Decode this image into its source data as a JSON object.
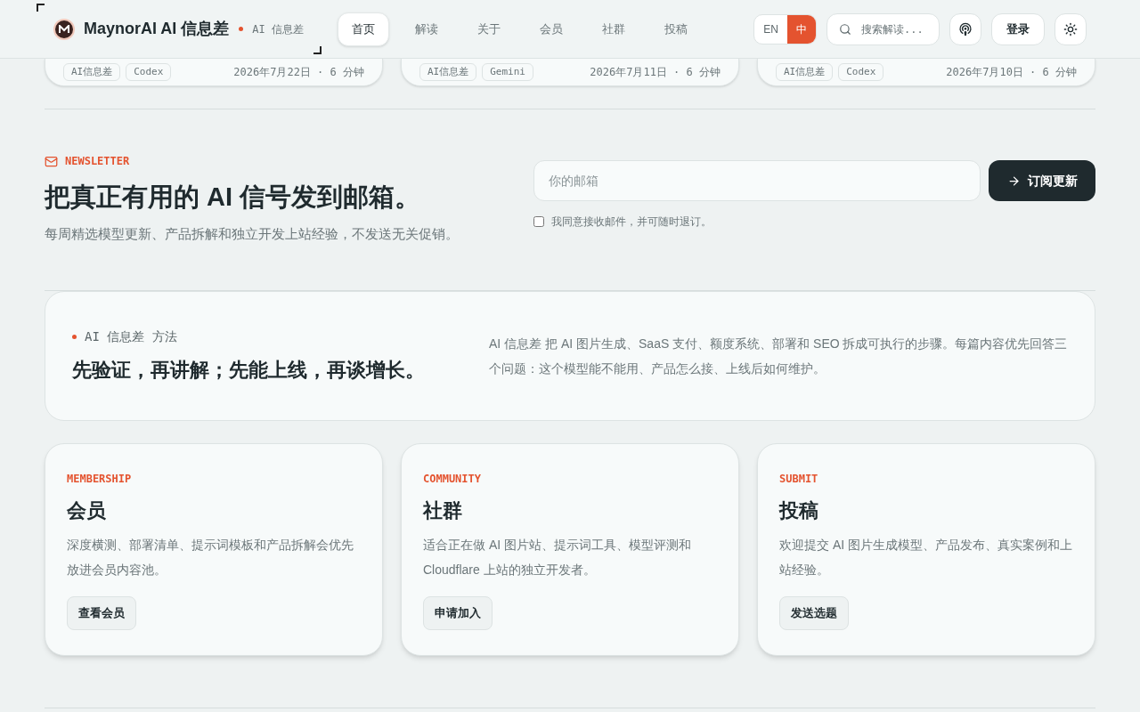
{
  "header": {
    "brand": "MaynorAI AI 信息差",
    "tagline": "AI 信息差",
    "nav": [
      {
        "label": "首页",
        "selected": true
      },
      {
        "label": "解读",
        "selected": false
      },
      {
        "label": "关于",
        "selected": false
      },
      {
        "label": "会员",
        "selected": false
      },
      {
        "label": "社群",
        "selected": false
      },
      {
        "label": "投稿",
        "selected": false
      }
    ],
    "languages": [
      {
        "label": "EN",
        "selected": false
      },
      {
        "label": "中",
        "selected": true
      }
    ],
    "search": {
      "placeholder": "搜索解读..."
    },
    "login": "登录"
  },
  "article_cards": [
    {
      "tags": [
        "AI信息差",
        "Codex"
      ],
      "meta": "2026年7月22日 · 6 分钟"
    },
    {
      "tags": [
        "AI信息差",
        "Gemini"
      ],
      "meta": "2026年7月11日 · 6 分钟"
    },
    {
      "tags": [
        "AI信息差",
        "Codex"
      ],
      "meta": "2026年7月10日 · 6 分钟"
    }
  ],
  "newsletter": {
    "eyebrow": "NEWSLETTER",
    "title": "把真正有用的 **AI** 信号发到邮箱。",
    "subtitle": "每周精选模型更新、产品拆解和独立开发上站经验，不发送无关促销。",
    "email_placeholder": "你的邮箱",
    "submit": "订阅更新",
    "consent": {
      "label": "我同意接收邮件，并可随时退订。",
      "checked": false
    }
  },
  "method": {
    "eyebrow": "AI 信息差 方法",
    "title": "先验证，再讲解；先能上线，再谈增长。",
    "body": "AI 信息差 把 AI 图片生成、SaaS 支付、额度系统、部署和 SEO 拆成可执行的步骤。每篇内容优先回答三个问题：这个模型能不能用、产品怎么接、上线后如何维护。"
  },
  "feature_cards": [
    {
      "eyebrow": "MEMBERSHIP",
      "title": "会员",
      "body": "深度横测、部署清单、提示词模板和产品拆解会优先放进会员内容池。",
      "action": "查看会员"
    },
    {
      "eyebrow": "COMMUNITY",
      "title": "社群",
      "body": "适合正在做 AI 图片站、提示词工具、模型评测和 Cloudflare 上站的独立开发者。",
      "action": "申请加入"
    },
    {
      "eyebrow": "SUBMIT",
      "title": "投稿",
      "body": "欢迎提交 AI 图片生成模型、产品发布、真实案例和上站经验。",
      "action": "发送选题"
    }
  ]
}
